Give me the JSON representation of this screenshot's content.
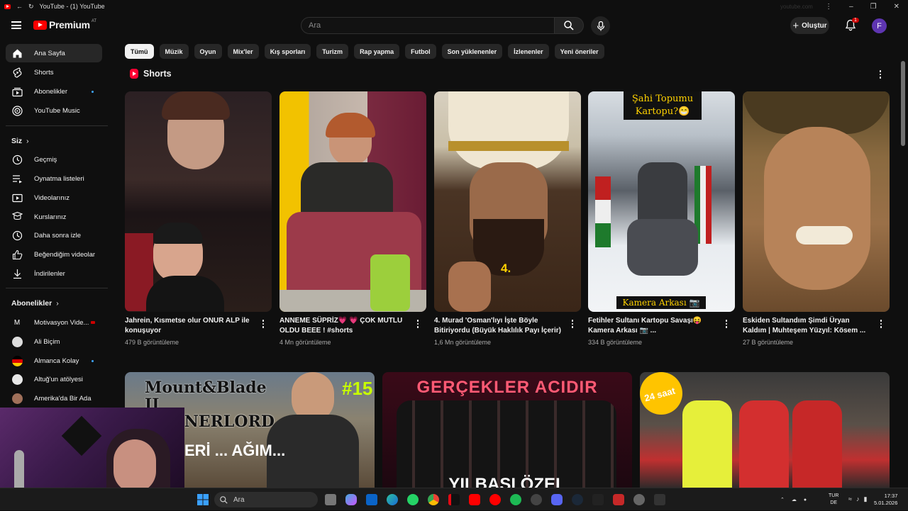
{
  "window": {
    "title": "YouTube - (1) YouTube",
    "url": "youtube.com"
  },
  "header": {
    "brand": "Premium",
    "country": "AT",
    "search_placeholder": "Ara",
    "create_label": "Oluştur",
    "notification_count": "1",
    "avatar_initial": "F"
  },
  "sidebar": {
    "main": [
      {
        "label": "Ana Sayfa",
        "icon": "home-icon"
      },
      {
        "label": "Shorts",
        "icon": "shorts-icon"
      },
      {
        "label": "Abonelikler",
        "icon": "subscriptions-icon"
      },
      {
        "label": "YouTube Music",
        "icon": "music-icon"
      }
    ],
    "you_title": "Siz",
    "you": [
      {
        "label": "Geçmiş",
        "icon": "history-icon"
      },
      {
        "label": "Oynatma listeleri",
        "icon": "playlists-icon"
      },
      {
        "label": "Videolarınız",
        "icon": "your-videos-icon"
      },
      {
        "label": "Kurslarınız",
        "icon": "courses-icon"
      },
      {
        "label": "Daha sonra izle",
        "icon": "watch-later-icon"
      },
      {
        "label": "Beğendiğim videolar",
        "icon": "liked-icon"
      },
      {
        "label": "İndirilenler",
        "icon": "download-icon"
      }
    ],
    "subs_title": "Abonelikler",
    "subscriptions": [
      {
        "label": "Motivasyon Vide...",
        "avatar": "M"
      },
      {
        "label": "Ali Biçim"
      },
      {
        "label": "Almanca Kolay"
      },
      {
        "label": "Altuğ'un atölyesi"
      },
      {
        "label": "Amerika'da Bir Ada"
      }
    ]
  },
  "chips": [
    "Tümü",
    "Müzik",
    "Oyun",
    "Mix'ler",
    "Kış sporları",
    "Turizm",
    "Rap yapma",
    "Futbol",
    "Son yüklenenler",
    "İzlenenler",
    "Yeni öneriler"
  ],
  "shorts": {
    "heading": "Shorts",
    "items": [
      {
        "title": "Jahrein, Kısmetse olur ONUR ALP ile konuşuyor",
        "views": "479 B görüntüleme"
      },
      {
        "title": "ANNEME SÜPRİZ💗 💗 ÇOK MUTLU OLDU BEEE ! #shorts",
        "views": "4 Mn görüntüleme"
      },
      {
        "title": "4. Murad 'Osman'lıyı İşte Böyle Bitiriyordu (Büyük Haklılık Payı İçerir)",
        "views": "1,6 Mn görüntüleme"
      },
      {
        "title": "Fetihler Sultanı Kartopu Savaşı😝 Kamera Arkası 📷 ...",
        "views": "334 B görüntüleme"
      },
      {
        "title": "Eskiden Sultandım Şimdi Üryan Kaldım | Muhteşem Yüzyıl: Kösem ...",
        "views": "27 B görüntüleme"
      }
    ],
    "overlay_texts": {
      "murad_number": "4.",
      "snow_top": "Şahi Topumu Kartopu?😁",
      "snow_bottom": "Kamera Arkası 📷"
    }
  },
  "videos": [
    {
      "thumb_title": "Mount&Blade II BANNERLORD",
      "badge": "#15",
      "sub_text": "ERİ ... AĞIM..."
    },
    {
      "thumb_title": "GERÇEKLER ACIDIR",
      "sub_text": "YILBAŞI ÖZEL"
    },
    {
      "thumb_badge": "24 saat"
    }
  ],
  "taskbar": {
    "search_label": "Ara",
    "lang_top": "TUR",
    "lang_bottom": "DE",
    "time": "17:37",
    "date": "5.01.2026"
  },
  "colors": {
    "accent_red": "#ff0000",
    "background": "#0f0f0f",
    "chip_bg": "#272727",
    "link_blue": "#3ea6ff"
  }
}
